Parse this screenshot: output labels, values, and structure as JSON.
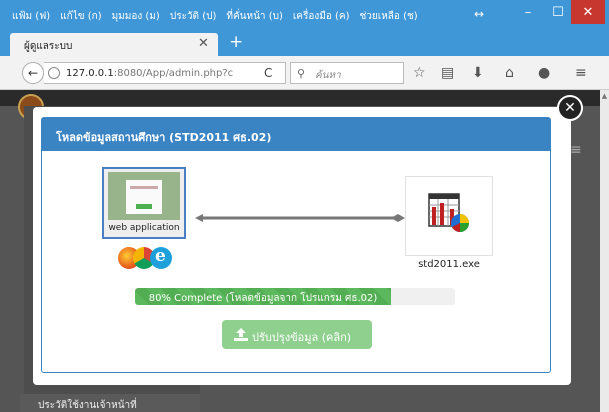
{
  "browser": {
    "menu": [
      "แฟ้ม (ฟ)",
      "แก้ไข (ก)",
      "มุมมอง (ม)",
      "ประวัติ (ป)",
      "ที่คั่นหน้า (บ)",
      "เครื่องมือ (ค)",
      "ช่วยเหลือ (ช)"
    ],
    "tab_title": "ผู้ดูแลระบบ",
    "url_host": "127.0.0.1",
    "url_path": ":8080/App/admin.php?c",
    "search_placeholder": "ค้นหา"
  },
  "page": {
    "sidebar_item": "ประวัติใช้งานเจ้าหน้าที่"
  },
  "modal": {
    "title": "โหลดข้อมูลสถานศึกษา (STD2011 ศธ.02)",
    "webapp_label": "web application",
    "exe_label": "std2011.exe",
    "progress_percent": 80,
    "progress_text": "80% Complete (โหลดข้อมูลจาก โปรแกรม ศธ.02)",
    "update_button": "ปรับปรุงข้อมูล (คลิก)"
  },
  "icons": [
    "back-icon",
    "globe-icon",
    "reload-icon",
    "search-icon",
    "star-icon",
    "reading-list-icon",
    "download-icon",
    "home-icon",
    "chat-icon",
    "hamburger-menu-icon",
    "close-icon",
    "upload-icon",
    "firefox-icon",
    "chrome-icon",
    "ie-icon",
    "spreadsheet-chart-icon"
  ],
  "colors": {
    "accent": "#3b84c4",
    "progress": "#5cb85c",
    "button": "#8fd08f",
    "close_window": "#c7372f"
  }
}
